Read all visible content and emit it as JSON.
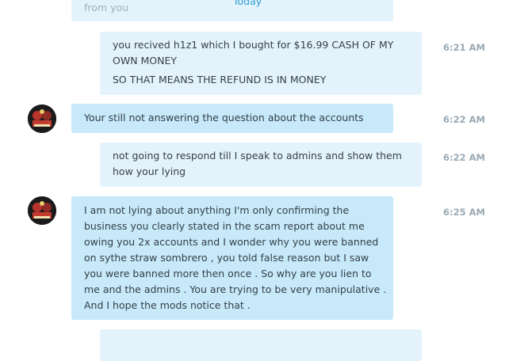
{
  "day_separator": "Today",
  "messages": [
    {
      "id": "m0",
      "direction": "out",
      "lines": [
        "from you"
      ],
      "time": ""
    },
    {
      "id": "m1",
      "direction": "out",
      "lines": [
        "you recived h1z1 which I bought for $16.99 CASH OF MY",
        "OWN MONEY",
        "SO THAT MEANS THE REFUND IS IN MONEY"
      ],
      "time": "6:21 AM"
    },
    {
      "id": "m2",
      "direction": "in",
      "lines": [
        "Your still not answering the question about the accounts"
      ],
      "time": "6:22 AM"
    },
    {
      "id": "m3",
      "direction": "out",
      "lines": [
        "not going to respond till I speak to admins and show them",
        "how your lying"
      ],
      "time": "6:22 AM"
    },
    {
      "id": "m4",
      "direction": "in",
      "lines": [
        "I am not lying about anything I'm only confirming the",
        "business you clearly stated in the scam report about me",
        "owing you 2x accounts and I wonder why you were banned",
        "on sythe straw sombrero , you told false reason but I saw",
        "you were banned more then once . So why are you lien to",
        "me and the admins . You are trying to be very manipulative .",
        "And I hope the mods notice that ."
      ],
      "time": "6:25 AM"
    }
  ],
  "colors": {
    "incoming_bubble": "#c7e9f9",
    "outgoing_bubble": "#e4f3fb",
    "timestamp": "#9aaab5",
    "link": "#2d9bd6"
  },
  "icons": {
    "avatar": "contact-avatar"
  }
}
